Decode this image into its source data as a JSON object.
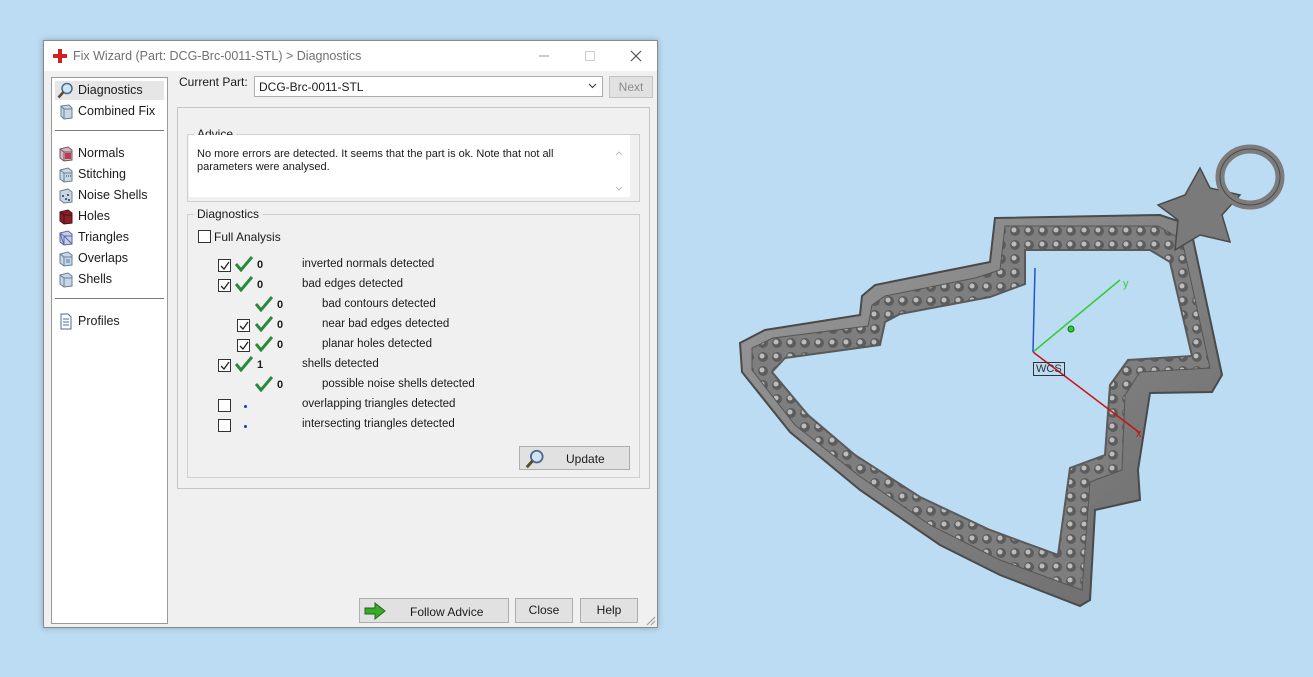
{
  "window": {
    "title": "Fix Wizard (Part: DCG-Brc-0011-STL) > Diagnostics"
  },
  "sidebar": {
    "items": [
      {
        "label": "Diagnostics",
        "icon": "magnifier-icon",
        "selected": true
      },
      {
        "label": "Combined Fix",
        "icon": "cube-icon"
      },
      {
        "label": "Normals",
        "icon": "normals-cube-icon"
      },
      {
        "label": "Stitching",
        "icon": "stitching-cube-icon"
      },
      {
        "label": "Noise Shells",
        "icon": "noise-shells-cube-icon"
      },
      {
        "label": "Holes",
        "icon": "holes-cube-icon"
      },
      {
        "label": "Triangles",
        "icon": "triangles-cube-icon"
      },
      {
        "label": "Overlaps",
        "icon": "overlaps-cube-icon"
      },
      {
        "label": "Shells",
        "icon": "shells-cube-icon"
      },
      {
        "label": "Profiles",
        "icon": "document-icon"
      }
    ]
  },
  "header": {
    "current_part_label": "Current Part:",
    "current_part_value": "DCG-Brc-0011-STL",
    "next_label": "Next"
  },
  "advice": {
    "title": "Advice",
    "text": "No more errors are detected. It seems that the part is ok. Note that not all parameters were analysed."
  },
  "diagnostics": {
    "title": "Diagnostics",
    "full_analysis_label": "Full Analysis",
    "full_analysis_checked": false,
    "rows": [
      {
        "checked": true,
        "status": "ok",
        "count": "0",
        "label": "inverted normals detected",
        "indent": 0
      },
      {
        "checked": true,
        "status": "ok",
        "count": "0",
        "label": "bad edges detected",
        "indent": 0
      },
      {
        "checked": null,
        "status": "ok",
        "count": "0",
        "label": "bad contours detected",
        "indent": 1
      },
      {
        "checked": true,
        "status": "ok",
        "count": "0",
        "label": "near bad edges detected",
        "indent": 1
      },
      {
        "checked": true,
        "status": "ok",
        "count": "0",
        "label": "planar holes detected",
        "indent": 1
      },
      {
        "checked": true,
        "status": "ok",
        "count": "1",
        "label": "shells detected",
        "indent": 0
      },
      {
        "checked": null,
        "status": "ok",
        "count": "0",
        "label": "possible noise shells detected",
        "indent": 1
      },
      {
        "checked": false,
        "status": "pending",
        "count": "",
        "label": "overlapping triangles detected",
        "indent": 0
      },
      {
        "checked": false,
        "status": "pending",
        "count": "",
        "label": "intersecting triangles detected",
        "indent": 0
      }
    ],
    "update_label": "Update"
  },
  "footer": {
    "follow_advice_label": "Follow Advice",
    "close_label": "Close",
    "help_label": "Help"
  },
  "viewport": {
    "wcs_label": "WCS",
    "axis_x_label": "x",
    "axis_y_label": "y"
  },
  "colors": {
    "desktop": "#bcdcf4",
    "check_green": "#2a8a3c",
    "axis_x": "#cc1111",
    "axis_y": "#33cc33",
    "axis_z": "#2255cc"
  }
}
